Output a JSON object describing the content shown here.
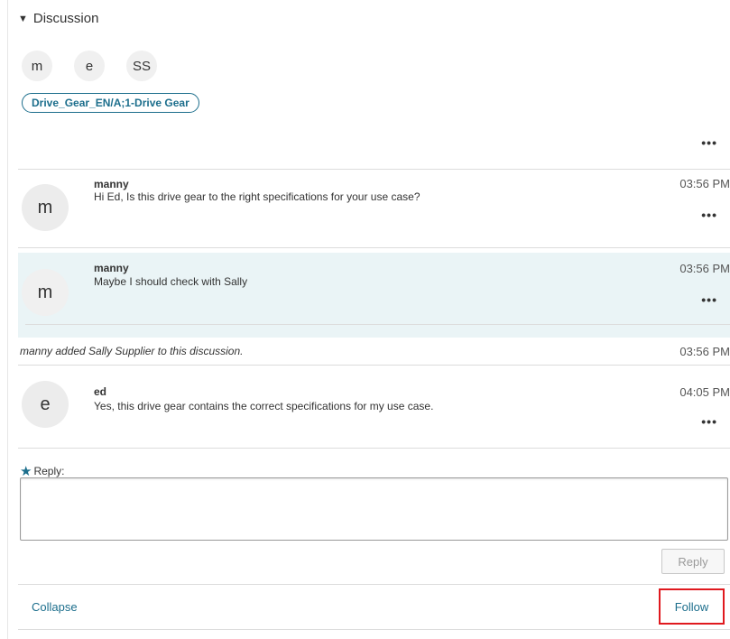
{
  "section": {
    "title": "Discussion",
    "toggle_glyph": "▼"
  },
  "participants": [
    "m",
    "e",
    "SS"
  ],
  "tag": "Drive_Gear_EN/A;1-Drive Gear",
  "more_glyph": "•••",
  "messages": [
    {
      "avatar": "m",
      "author": "manny",
      "text": "Hi Ed,  Is this drive gear to the right specifications for your use case?",
      "time": "03:56 PM"
    },
    {
      "avatar": "m",
      "author": "manny",
      "text": "Maybe I should check with Sally",
      "time": "03:56 PM"
    },
    {
      "avatar": "e",
      "author": "ed",
      "text": "Yes, this drive gear contains the correct specifications for my use case.",
      "time": "04:05 PM"
    }
  ],
  "activity": {
    "text": "manny added Sally Supplier to this discussion.",
    "time": "03:56 PM"
  },
  "reply": {
    "label": "Reply:",
    "required_marker": "★",
    "value": "",
    "button": "Reply"
  },
  "footer": {
    "collapse": "Collapse",
    "follow": "Follow"
  },
  "colors": {
    "accent": "#1c6e8c",
    "highlight_bg": "#eaf4f6",
    "follow_outline": "#e0191e"
  }
}
